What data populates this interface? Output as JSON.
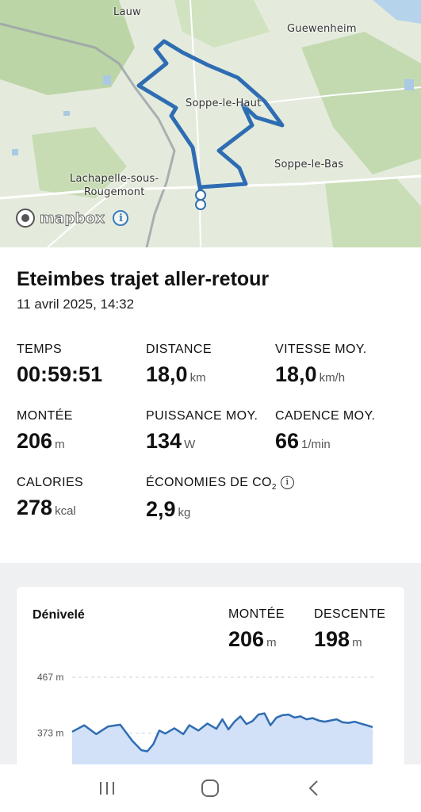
{
  "map": {
    "places": [
      {
        "name": "Lauw"
      },
      {
        "name": "Guewenheim"
      },
      {
        "name": "Soppe-le-Haut"
      },
      {
        "name": "Soppe-le-Bas"
      },
      {
        "name": "Lachapelle-sous-\nRougemont"
      }
    ],
    "attribution": "mapbox",
    "route_color": "#2f6db3"
  },
  "ride": {
    "title": "Eteimbes trajet aller-retour",
    "date": "11 avril 2025, 14:32"
  },
  "stats": {
    "temps": {
      "label": "TEMPS",
      "value": "00:59:51",
      "unit": ""
    },
    "distance": {
      "label": "DISTANCE",
      "value": "18,0",
      "unit": "km"
    },
    "vitesse": {
      "label": "VITESSE MOY.",
      "value": "18,0",
      "unit": "km/h"
    },
    "montee": {
      "label": "MONTÉE",
      "value": "206",
      "unit": "m"
    },
    "puissance": {
      "label": "PUISSANCE MOY.",
      "value": "134",
      "unit": "W"
    },
    "cadence": {
      "label": "CADENCE MOY.",
      "value": "66",
      "unit": "1/min"
    },
    "calories": {
      "label": "CALORIES",
      "value": "278",
      "unit": "kcal"
    },
    "co2": {
      "label_prefix": "ÉCONOMIES DE CO",
      "label_sub": "2",
      "value": "2,9",
      "unit": "kg"
    }
  },
  "elevation": {
    "title": "Dénivelé",
    "montee": {
      "label": "MONTÉE",
      "value": "206",
      "unit": "m"
    },
    "descente": {
      "label": "DESCENTE",
      "value": "198",
      "unit": "m"
    },
    "chart_data": {
      "type": "area",
      "title": "Dénivelé",
      "y_tick_labels": [
        "467 m",
        "373 m"
      ],
      "y_ticks": [
        467,
        373
      ],
      "ylim": [
        320,
        467
      ],
      "x": [
        0,
        0.04,
        0.08,
        0.12,
        0.16,
        0.2,
        0.23,
        0.25,
        0.27,
        0.29,
        0.31,
        0.34,
        0.37,
        0.39,
        0.42,
        0.45,
        0.48,
        0.5,
        0.52,
        0.54,
        0.56,
        0.58,
        0.6,
        0.62,
        0.64,
        0.66,
        0.68,
        0.7,
        0.72,
        0.74,
        0.76,
        0.78,
        0.8,
        0.82,
        0.84,
        0.86,
        0.88,
        0.9,
        0.92,
        0.94,
        0.96,
        0.98,
        1.0
      ],
      "values": [
        375,
        386,
        371,
        384,
        387,
        360,
        344,
        342,
        354,
        377,
        372,
        381,
        371,
        386,
        377,
        389,
        380,
        396,
        379,
        392,
        401,
        388,
        393,
        404,
        406,
        386,
        399,
        403,
        404,
        399,
        401,
        396,
        398,
        394,
        392,
        394,
        396,
        391,
        390,
        392,
        389,
        386,
        383
      ],
      "fill_color": "#d2e1f7",
      "line_color": "#2f6db3"
    }
  },
  "navbar": {
    "items": [
      {
        "name": "recents-icon"
      },
      {
        "name": "home-icon"
      },
      {
        "name": "back-icon"
      }
    ]
  }
}
